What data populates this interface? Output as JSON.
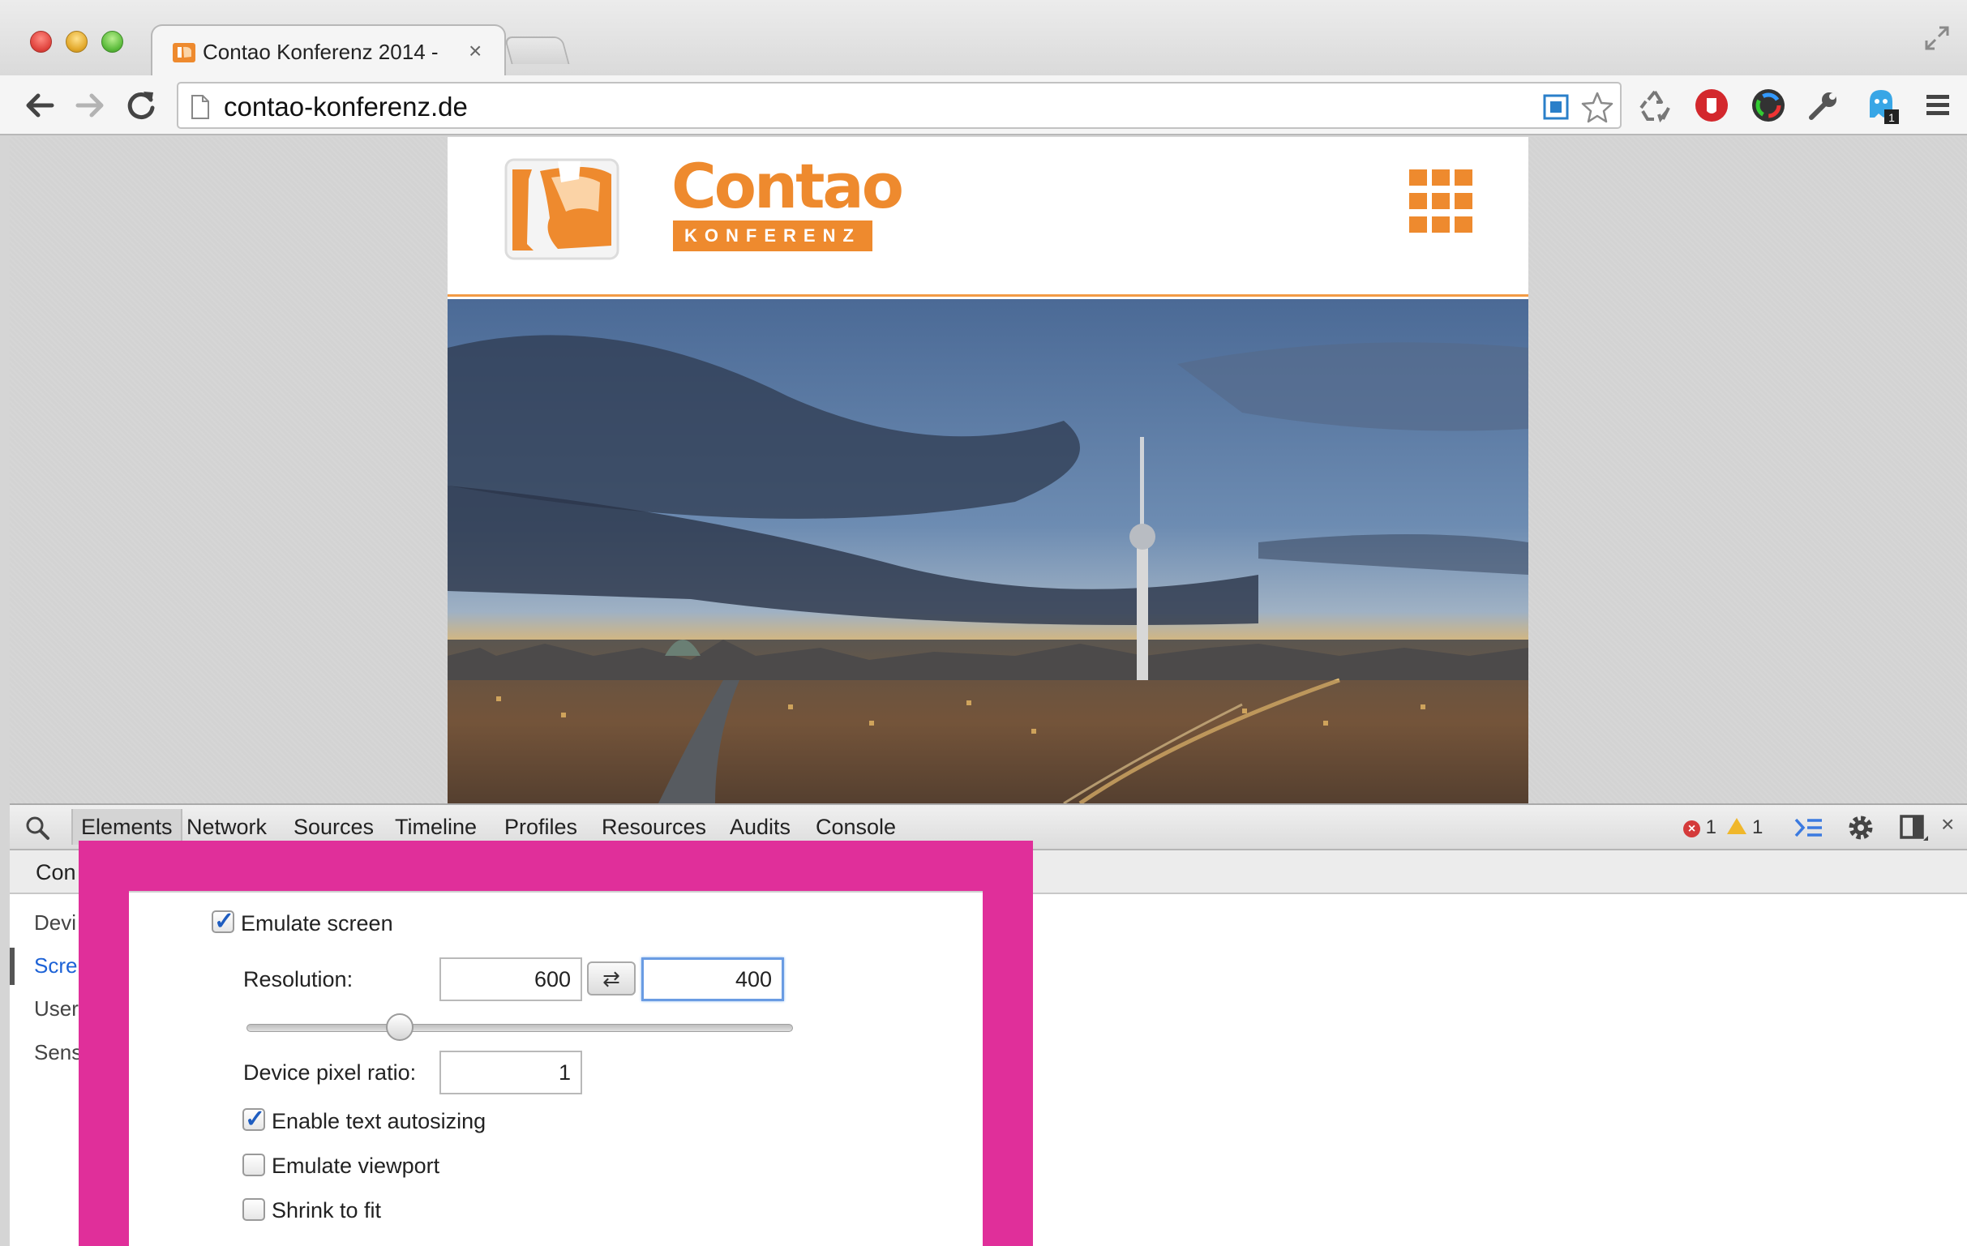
{
  "browser": {
    "tab_title": "Contao Konferenz 2014 -",
    "tab_close": "×",
    "url": "contao-konferenz.de"
  },
  "site": {
    "brand": "Contao",
    "brand_sub": "KONFERENZ",
    "accent_color": "#ee8a2e"
  },
  "devtools": {
    "tabs": [
      "Elements",
      "Network",
      "Sources",
      "Timeline",
      "Profiles",
      "Resources",
      "Audits",
      "Console"
    ],
    "active_tab": "Elements",
    "error_count": "1",
    "warning_count": "1",
    "close": "×",
    "drawer_tab": "Con",
    "sidebar": {
      "device": "Devi",
      "screen": "Scre",
      "user_agent": "User     nt",
      "sensors": "Sens"
    },
    "screen_panel": {
      "emulate_screen": "Emulate screen",
      "emulate_screen_checked": true,
      "resolution_label": "Resolution:",
      "resolution_width": "600",
      "resolution_height": "400",
      "swap_glyph": "⇄",
      "slider_value": 0.28,
      "pixel_ratio_label": "Device pixel ratio:",
      "pixel_ratio": "1",
      "text_autosizing": "Enable text autosizing",
      "text_autosizing_checked": true,
      "emulate_viewport": "Emulate viewport",
      "emulate_viewport_checked": false,
      "shrink_to_fit": "Shrink to fit",
      "shrink_to_fit_checked": false
    }
  },
  "colors": {
    "highlight": "#e02f9a",
    "link_blue": "#1d62d6"
  }
}
